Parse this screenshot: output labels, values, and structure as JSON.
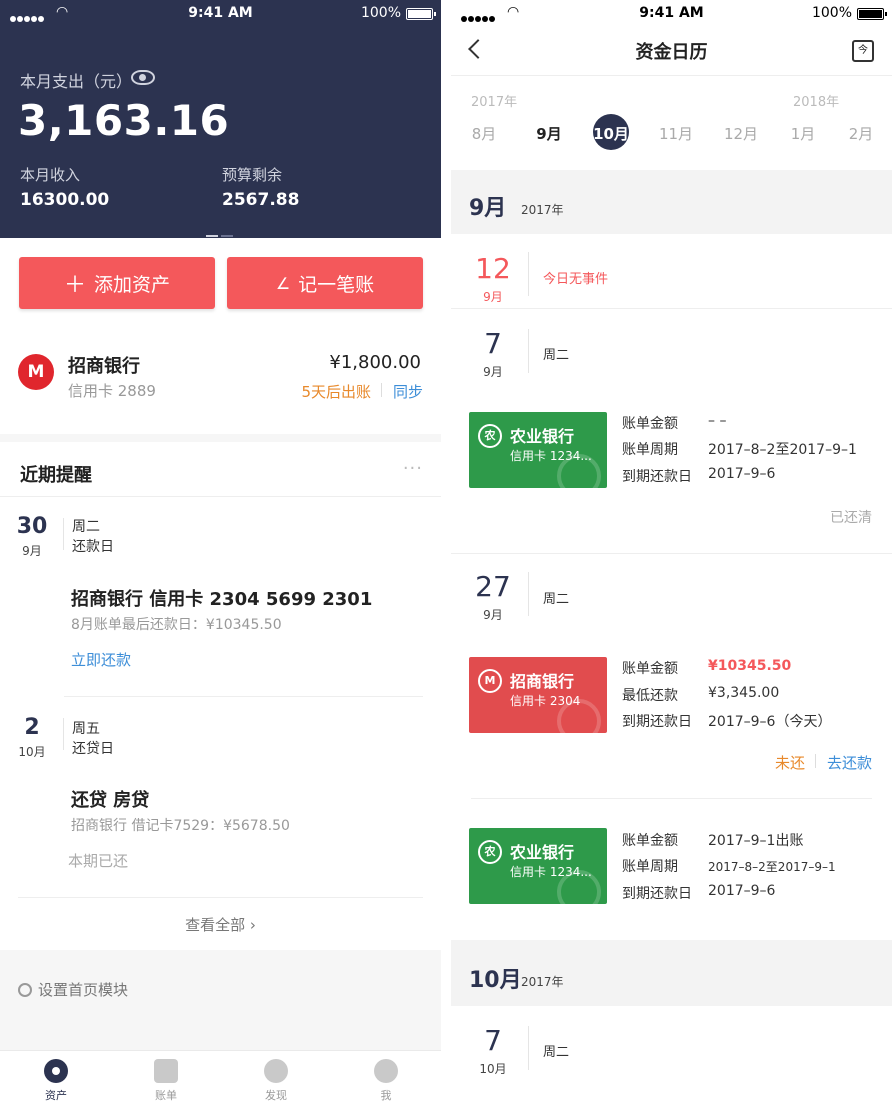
{
  "left": {
    "status": {
      "time": "9:41 AM",
      "battery": "100%"
    },
    "summary": {
      "spend_label": "本月支出（元）",
      "spend_amount": "3,163.16",
      "income_label": "本月收入",
      "income_value": "16300.00",
      "budget_label": "预算剩余",
      "budget_value": "2567.88"
    },
    "actions": {
      "add_asset": "添加资产",
      "add_asset_icon": "plus-icon",
      "record": "记一笔账",
      "record_icon": "pen-icon"
    },
    "bank_card": {
      "logo": "M",
      "name": "招商银行",
      "card": "信用卡 2889",
      "amount": "¥1,800.00",
      "bill": "5天后出账",
      "sync": "同步"
    },
    "reminders": {
      "title": "近期提醒",
      "more": "···",
      "items": [
        {
          "day": "30",
          "month": "9月",
          "weekday": "周二",
          "type": "还款日",
          "headline": "招商银行   信用卡 2304 5699 2301",
          "detail": "8月账单最后还款日：¥10345.50",
          "action": "立即还款"
        },
        {
          "day": "2",
          "month": "10月",
          "weekday": "周五",
          "type": "还贷日",
          "headline": "还贷   房贷",
          "detail": "招商银行 借记卡7529：¥5678.50",
          "status": "本期已还"
        }
      ],
      "view_all": "查看全部 ›"
    },
    "settings": "设置首页模块",
    "tabs": [
      {
        "label": "资产",
        "icon": "asset-icon",
        "active": true
      },
      {
        "label": "账单",
        "icon": "bill-icon",
        "active": false
      },
      {
        "label": "发现",
        "icon": "compass-icon",
        "active": false
      },
      {
        "label": "我",
        "icon": "user-icon",
        "active": false
      }
    ]
  },
  "right": {
    "status": {
      "time": "9:41 AM",
      "battery": "100%"
    },
    "nav": {
      "title": "资金日历",
      "today": "今"
    },
    "month_strip": {
      "years": [
        "2017年",
        "2018年"
      ],
      "months": [
        "8月",
        "9月",
        "10月",
        "11月",
        "12月",
        "1月",
        "2月"
      ],
      "selected": "10月"
    },
    "sections": [
      {
        "month": "9月",
        "year": "2017年"
      },
      {
        "month": "10月",
        "year": "2017年"
      }
    ],
    "events": {
      "today": {
        "day": "12",
        "month": "9月",
        "text": "今日无事件"
      },
      "sep7": {
        "day": "7",
        "month": "9月",
        "weekday": "周二",
        "card": {
          "logo": "农",
          "bank": "农业银行",
          "number": "信用卡 1234..."
        },
        "labels": [
          "账单金额",
          "账单周期",
          "到期还款日"
        ],
        "values": [
          "– –",
          "2017–8–2至2017–9–1",
          "2017–9–6"
        ],
        "status": "已还清"
      },
      "sep27": {
        "day": "27",
        "month": "9月",
        "weekday": "周二",
        "card1": {
          "logo": "M",
          "bank": "招商银行",
          "number": "信用卡 2304"
        },
        "labels1": [
          "账单金额",
          "最低还款",
          "到期还款日"
        ],
        "values1": [
          "¥10345.50",
          "¥3,345.00",
          "2017–9–6（今天）"
        ],
        "unpaid": "未还",
        "repay": "去还款",
        "card2": {
          "logo": "农",
          "bank": "农业银行",
          "number": "信用卡 1234..."
        },
        "labels2": [
          "账单金额",
          "账单周期",
          "到期还款日"
        ],
        "values2": [
          "2017–9–1出账",
          "2017–8–2至2017–9–1",
          "2017–9–6"
        ]
      },
      "oct7": {
        "day": "7",
        "month": "10月",
        "weekday": "周二"
      }
    },
    "colors": {
      "navy": "#2c3350",
      "red": "#f4585b",
      "green": "#2e9a4a",
      "blue": "#3d8ed8",
      "orange": "#e8892b"
    }
  }
}
